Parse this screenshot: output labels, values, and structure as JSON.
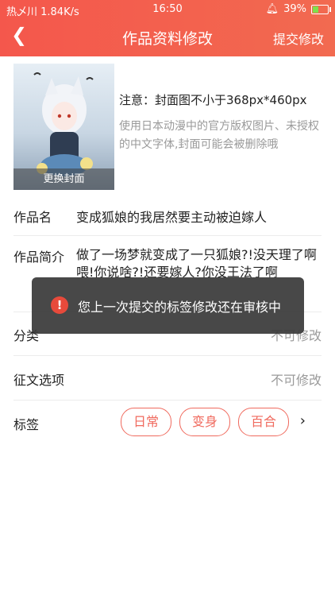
{
  "status_bar": {
    "left": "热乄川 1.84K/s",
    "time": "16:50",
    "battery": "39%",
    "battery_level_percent": 39
  },
  "header": {
    "back_icon": "chevron-left-icon",
    "title": "作品资料修改",
    "submit_label": "提交修改"
  },
  "cover": {
    "change_button": "更换封面",
    "notice_title": "注意：封面图不小于368px*460px",
    "notice_text": "使用日本动漫中的官方版权图片、未授权的中文字体,封面可能会被删除哦"
  },
  "fields": {
    "name": {
      "label": "作品名",
      "value": "变成狐娘的我居然要主动被迫嫁人"
    },
    "intro": {
      "label": "作品简介",
      "value": "做了一场梦就变成了一只狐娘?!没天理了啊喂!你说啥?!还要嫁人?你没王法了啊"
    },
    "category": {
      "label": "分类",
      "value": "不可修改"
    },
    "contest": {
      "label": "征文选项",
      "value": "不可修改"
    },
    "tags": {
      "label": "标签",
      "items": [
        "日常",
        "变身",
        "百合"
      ],
      "more_icon": "chevron-right-icon"
    }
  },
  "toast": {
    "icon": "alert-icon",
    "message": "您上一次提交的标签修改还在审核中"
  },
  "colors": {
    "accent": "#f4574c",
    "tag_border": "#f06a5e"
  }
}
